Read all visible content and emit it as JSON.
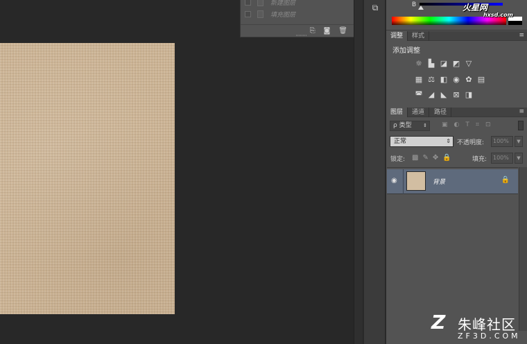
{
  "history": {
    "items": [
      {
        "label": "新建图层"
      },
      {
        "label": "填充图层"
      }
    ],
    "footer_icons": [
      "new-document-icon",
      "camera-icon",
      "trash-icon"
    ]
  },
  "color": {
    "channel_label": "B"
  },
  "adjustments": {
    "tabs": [
      "调整",
      "样式"
    ],
    "title": "添加调整"
  },
  "layers": {
    "tabs": [
      "图层",
      "通道",
      "路径"
    ],
    "filter_label": "ρ 类型",
    "blend_mode": "正常",
    "opacity_label": "不透明度:",
    "opacity_value": "100%",
    "lock_label": "锁定:",
    "fill_label": "填充:",
    "fill_value": "100%",
    "layer_name": "背景"
  },
  "watermarks": {
    "top": "火星网",
    "top_sub": "hxsd.com",
    "bottom_cn": "朱峰社区",
    "bottom_en": "ZF3D.COM"
  }
}
